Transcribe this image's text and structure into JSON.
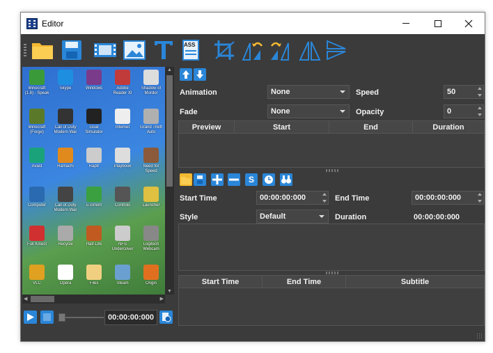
{
  "window": {
    "title": "Editor"
  },
  "toolbar": {
    "icons": [
      "folder-open-icon",
      "save-icon",
      "film-icon",
      "image-icon",
      "text-icon",
      "ass-subtitle-icon",
      "crop-icon",
      "rotate-left-icon",
      "rotate-right-icon",
      "flip-horizontal-icon",
      "flip-vertical-icon"
    ],
    "ass_label": "ASS"
  },
  "desktop_icons": [
    {
      "label": "Minecraft (1.8) - Speak"
    },
    {
      "label": "Skype"
    },
    {
      "label": "Windows"
    },
    {
      "label": "Adobe Reader XI"
    },
    {
      "label": "Shadow of Mordor"
    },
    {
      "label": "Minecraft (Forge)"
    },
    {
      "label": "Call of Duty Modern War"
    },
    {
      "label": "Goat Simulator"
    },
    {
      "label": "Internet"
    },
    {
      "label": "Grand Theft Auto"
    },
    {
      "label": "Avast"
    },
    {
      "label": "Hamachi"
    },
    {
      "label": "Raptr"
    },
    {
      "label": "Playbook"
    },
    {
      "label": "Need for Speed"
    },
    {
      "label": "Computer"
    },
    {
      "label": "Call of Duty Modern War"
    },
    {
      "label": "uTorrent"
    },
    {
      "label": "Controls"
    },
    {
      "label": "Launcher"
    },
    {
      "label": "Full Kinect"
    },
    {
      "label": "Recycle"
    },
    {
      "label": "Half-Life"
    },
    {
      "label": "NFS Undercover"
    },
    {
      "label": "Logitech Webcam"
    },
    {
      "label": "VLC"
    },
    {
      "label": "Opera"
    },
    {
      "label": "Files"
    },
    {
      "label": "Steam"
    },
    {
      "label": "Origin"
    }
  ],
  "player": {
    "time": "00:00:00:000"
  },
  "animation": {
    "label": "Animation",
    "value": "None"
  },
  "fade": {
    "label": "Fade",
    "value": "None"
  },
  "speed": {
    "label": "Speed",
    "value": "50"
  },
  "opacity": {
    "label": "Opacity",
    "value": "0"
  },
  "anim_grid": {
    "columns": [
      "Preview",
      "Start",
      "End",
      "Duration"
    ]
  },
  "subtitle": {
    "start_time_label": "Start Time",
    "start_time_value": "00:00:00:000",
    "end_time_label": "End Time",
    "end_time_value": "00:00:00:000",
    "style_label": "Style",
    "style_value": "Default",
    "duration_label": "Duration",
    "duration_value": "00:00:00:000",
    "s_button": "S"
  },
  "subtitle_grid": {
    "columns": [
      "Start Time",
      "End Time",
      "Subtitle"
    ]
  },
  "colors": {
    "accent": "#2a86d8",
    "background": "#3b3b3b"
  }
}
